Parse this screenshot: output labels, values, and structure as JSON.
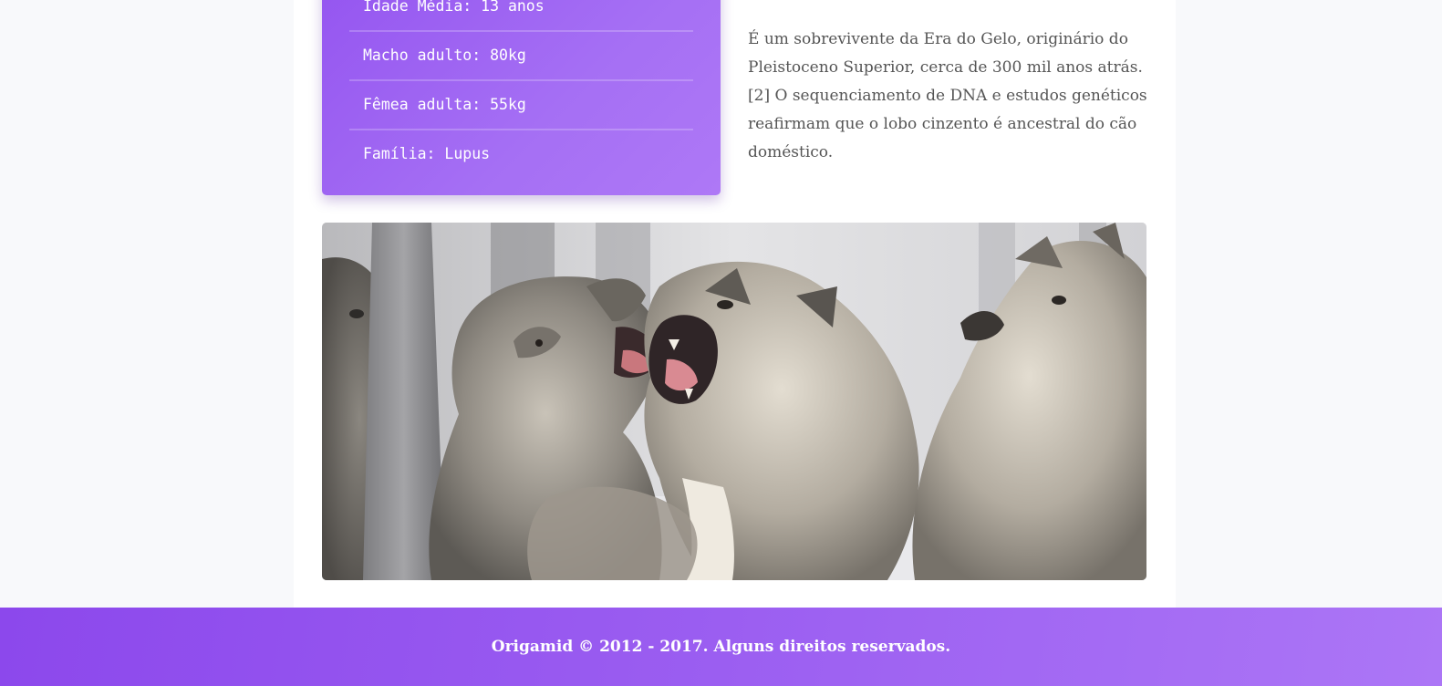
{
  "facts": {
    "items": [
      "Idade Média: 13 anos",
      "Macho adulto: 80kg",
      "Fêmea adulta: 55kg",
      "Família: Lupus"
    ]
  },
  "description": {
    "text": "É um sobrevivente da Era do Gelo, originário do Pleistoceno Superior, cerca de 300 mil anos atrás. [2] O sequenciamento de DNA e estudos genéticos reafirmam que o lobo cinzento é ancestral do cão doméstico."
  },
  "photo": {
    "subject": "wolves-photo"
  },
  "footer": {
    "text": "Origamid © 2012 - 2017. Alguns direitos reservados."
  },
  "colors": {
    "accent": "#9b5ef1",
    "accent_light": "#ae78f6",
    "text": "#555555",
    "background": "#f8f9fb"
  }
}
